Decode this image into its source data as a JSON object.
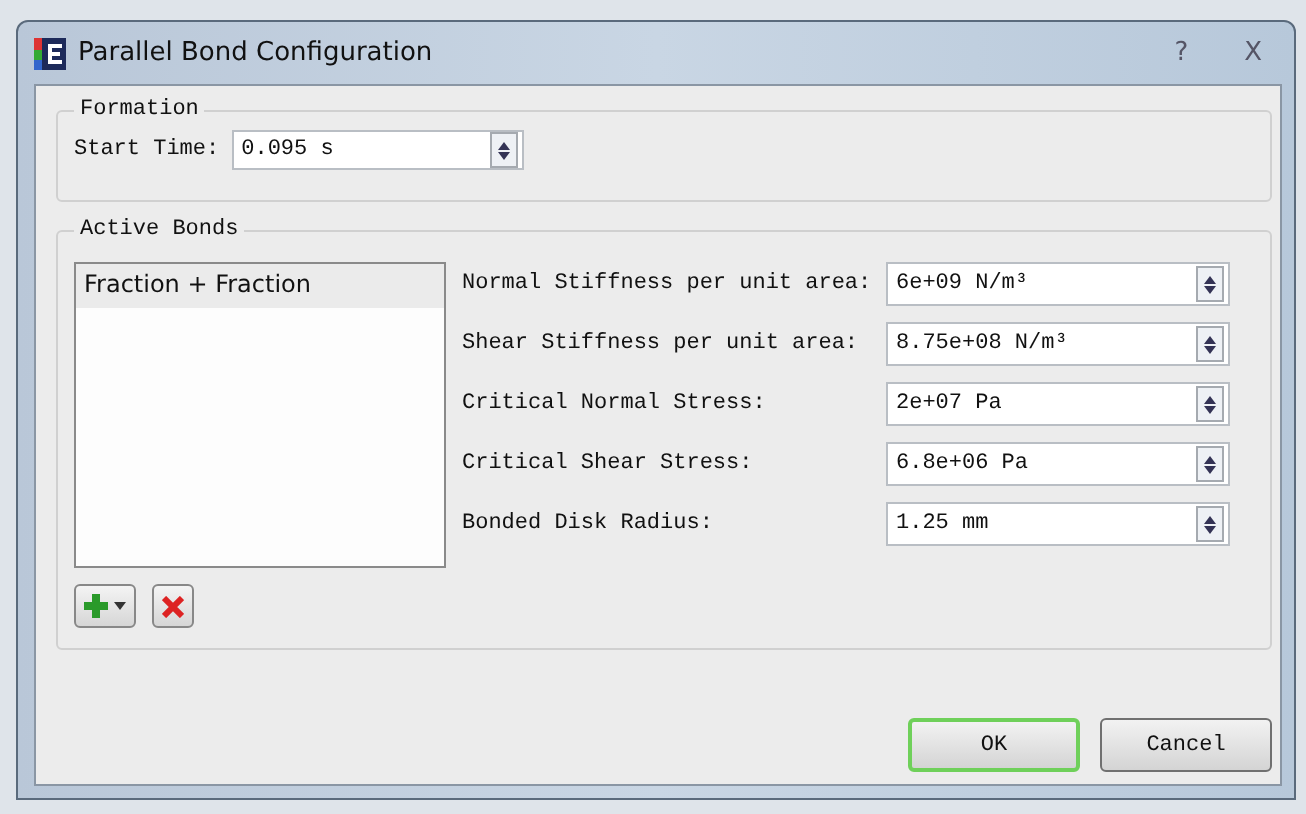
{
  "window": {
    "title": "Parallel Bond Configuration",
    "controls": [
      "?",
      "X"
    ]
  },
  "formation": {
    "title": "Formation",
    "start_time": {
      "label": "Start Time:",
      "value": "0.095 s"
    }
  },
  "active_bonds": {
    "title": "Active Bonds",
    "list": [
      {
        "label": "Fraction + Fraction",
        "selected": true
      }
    ],
    "properties": [
      {
        "label": "Normal Stiffness per unit area:",
        "value": "6e+09 N/m³"
      },
      {
        "label": "Shear Stiffness per unit area:",
        "value": "8.75e+08 N/m³"
      },
      {
        "label": "Critical Normal Stress:",
        "value": "2e+07 Pa"
      },
      {
        "label": "Critical Shear Stress:",
        "value": "6.8e+06 Pa"
      },
      {
        "label": "Bonded Disk Radius:",
        "value": "1.25 mm"
      }
    ]
  },
  "buttons": [
    {
      "label": "OK",
      "default": true
    },
    {
      "label": "Cancel",
      "default": false
    }
  ]
}
